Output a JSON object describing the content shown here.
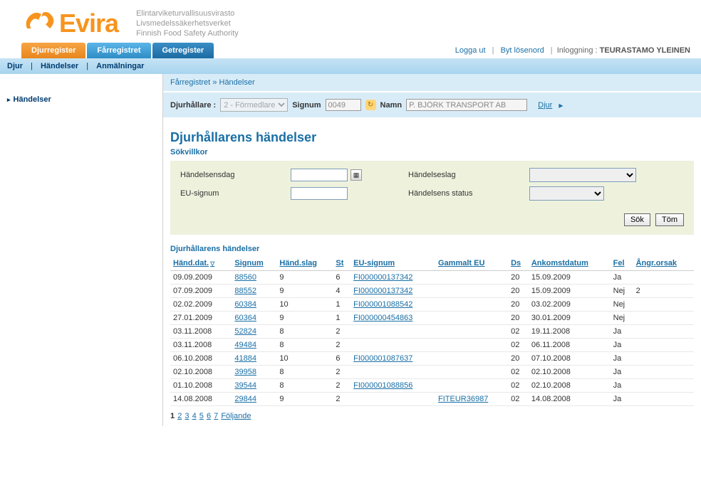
{
  "header": {
    "brand": "Evira",
    "sub1": "Elintarviketurvallisuusvirasto",
    "sub2": "Livsmedelssäkerhetsverket",
    "sub3": "Finnish Food Safety Authority"
  },
  "tabs": {
    "djurregister": "Djurregister",
    "farregistret": "Fårregistret",
    "getregister": "Getregister"
  },
  "headerLinks": {
    "logout": "Logga ut",
    "changepw": "Byt lösenord",
    "loginLabel": "Inloggning :",
    "loginName": "TEURASTAMO YLEINEN"
  },
  "subnav": {
    "djur": "Djur",
    "handelser": "Händelser",
    "anmalningar": "Anmälningar"
  },
  "sidebar": {
    "handelser": "Händelser"
  },
  "breadcrumb": {
    "root": "Fårregistret",
    "sep": "»",
    "current": "Händelser"
  },
  "filterbar": {
    "djurhallareLabel": "Djurhållare :",
    "djurhallareValue": "2 - Förmedlare",
    "signumLabel": "Signum",
    "signumValue": "0049",
    "namnLabel": "Namn",
    "namnValue": "P. BJÖRK TRANSPORT AB",
    "djurLink": "Djur"
  },
  "section": {
    "title": "Djurhållarens händelser",
    "sokvillkor": "Sökvillkor"
  },
  "search": {
    "handelsensdag": "Händelsensdag",
    "eusignum": "EU-signum",
    "handelseslag": "Händelseslag",
    "handelsensstatus": "Händelsens status",
    "sok": "Sök",
    "tom": "Töm"
  },
  "tableTitle": "Djurhållarens händelser",
  "columns": {
    "handdat": "Händ.dat.",
    "signum": "Signum",
    "handslag": "Händ.slag",
    "st": "St",
    "eusignum": "EU-signum",
    "gammalteu": "Gammalt EU",
    "ds": "Ds",
    "ankomstdatum": "Ankomstdatum",
    "fel": "Fel",
    "angrorsak": "Ångr.orsak"
  },
  "rows": [
    {
      "handdat": "09.09.2009",
      "signum": "88560",
      "handslag": "9",
      "st": "6",
      "eusignum": "FI000000137342",
      "gammalteu": "",
      "ds": "20",
      "ankomst": "15.09.2009",
      "fel": "Ja",
      "angr": ""
    },
    {
      "handdat": "07.09.2009",
      "signum": "88552",
      "handslag": "9",
      "st": "4",
      "eusignum": "FI000000137342",
      "gammalteu": "",
      "ds": "20",
      "ankomst": "15.09.2009",
      "fel": "Nej",
      "angr": "2"
    },
    {
      "handdat": "02.02.2009",
      "signum": "60384",
      "handslag": "10",
      "st": "1",
      "eusignum": "FI000001088542",
      "gammalteu": "",
      "ds": "20",
      "ankomst": "03.02.2009",
      "fel": "Nej",
      "angr": ""
    },
    {
      "handdat": "27.01.2009",
      "signum": "60364",
      "handslag": "9",
      "st": "1",
      "eusignum": "FI000000454863",
      "gammalteu": "",
      "ds": "20",
      "ankomst": "30.01.2009",
      "fel": "Nej",
      "angr": ""
    },
    {
      "handdat": "03.11.2008",
      "signum": "52824",
      "handslag": "8",
      "st": "2",
      "eusignum": "",
      "gammalteu": "",
      "ds": "02",
      "ankomst": "19.11.2008",
      "fel": "Ja",
      "angr": ""
    },
    {
      "handdat": "03.11.2008",
      "signum": "49484",
      "handslag": "8",
      "st": "2",
      "eusignum": "",
      "gammalteu": "",
      "ds": "02",
      "ankomst": "06.11.2008",
      "fel": "Ja",
      "angr": ""
    },
    {
      "handdat": "06.10.2008",
      "signum": "41884",
      "handslag": "10",
      "st": "6",
      "eusignum": "FI000001087637",
      "gammalteu": "",
      "ds": "20",
      "ankomst": "07.10.2008",
      "fel": "Ja",
      "angr": ""
    },
    {
      "handdat": "02.10.2008",
      "signum": "39958",
      "handslag": "8",
      "st": "2",
      "eusignum": "",
      "gammalteu": "",
      "ds": "02",
      "ankomst": "02.10.2008",
      "fel": "Ja",
      "angr": ""
    },
    {
      "handdat": "01.10.2008",
      "signum": "39544",
      "handslag": "8",
      "st": "2",
      "eusignum": "FI000001088856",
      "gammalteu": "",
      "ds": "02",
      "ankomst": "02.10.2008",
      "fel": "Ja",
      "angr": ""
    },
    {
      "handdat": "14.08.2008",
      "signum": "29844",
      "handslag": "9",
      "st": "2",
      "eusignum": "",
      "gammalteu": "FITEUR36987",
      "ds": "02",
      "ankomst": "14.08.2008",
      "fel": "Ja",
      "angr": ""
    }
  ],
  "pager": {
    "pages": [
      "1",
      "2",
      "3",
      "4",
      "5",
      "6",
      "7"
    ],
    "next": "Följande",
    "current": "1"
  }
}
